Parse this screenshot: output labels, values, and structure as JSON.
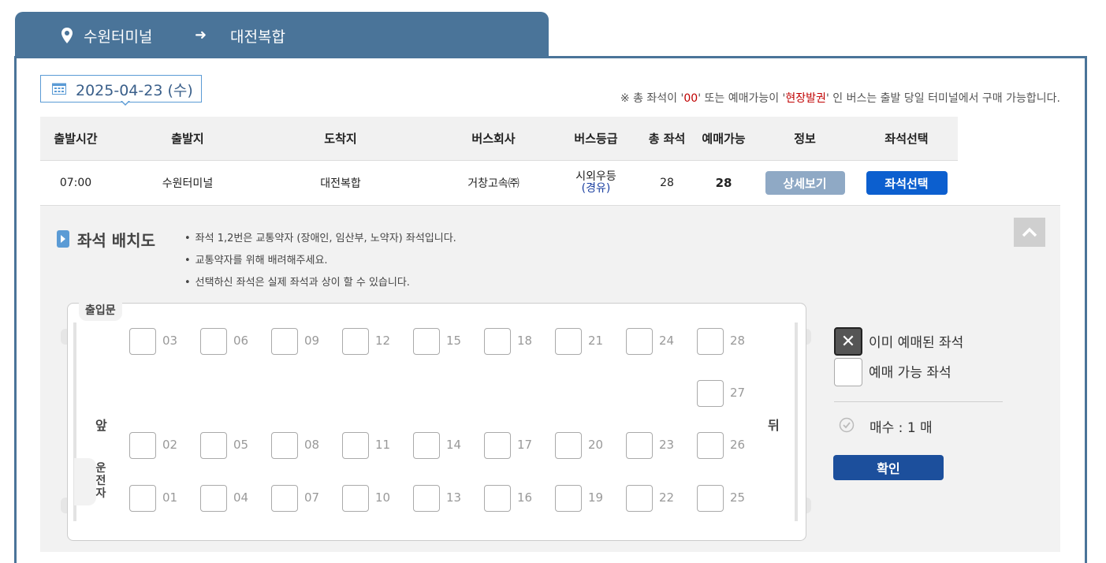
{
  "route": {
    "origin": "수원터미널",
    "arrow": "➜",
    "destination": "대전복합"
  },
  "date": {
    "label": "2025-04-23 (수)"
  },
  "notice": {
    "part1": "※ 총 좌석이 '",
    "red1": "00",
    "part2": "' 또는 예매가능이 '",
    "red2": "현장발권",
    "part3": "' 인 버스는 출발 당일 터미널에서 구매 가능합니다."
  },
  "table": {
    "headers": [
      "출발시간",
      "출발지",
      "도착지",
      "버스회사",
      "버스등급",
      "총 좌석",
      "예매가능",
      "정보",
      "좌석선택"
    ],
    "row": {
      "time": "07:00",
      "origin": "수원터미널",
      "destination": "대전복합",
      "company": "거창고속㈜",
      "grade": "시외우등",
      "grade_sub": "(경유)",
      "total_seats": "28",
      "available": "28",
      "detail_label": "상세보기",
      "select_label": "좌석선택"
    }
  },
  "seat_map": {
    "title": "좌석 배치도",
    "notes": [
      "좌석 1,2번은 교통약자 (장애인, 임산부, 노약자) 좌석입니다.",
      "교통약자를 위해 배려해주세요.",
      "선택하신 좌석은 실제 좌석과 상이 할 수 있습니다."
    ],
    "door_label": "출입문",
    "front_label": "앞",
    "back_label": "뒤",
    "driver_label": "운전자",
    "seats": {
      "s01": "01",
      "s02": "02",
      "s03": "03",
      "s04": "04",
      "s05": "05",
      "s06": "06",
      "s07": "07",
      "s08": "08",
      "s09": "09",
      "s10": "10",
      "s11": "11",
      "s12": "12",
      "s13": "13",
      "s14": "14",
      "s15": "15",
      "s16": "16",
      "s17": "17",
      "s18": "18",
      "s19": "19",
      "s20": "20",
      "s21": "21",
      "s22": "22",
      "s23": "23",
      "s24": "24",
      "s25": "25",
      "s26": "26",
      "s27": "27",
      "s28": "28"
    }
  },
  "legend": {
    "taken_label": "이미 예매된 좌석",
    "free_label": "예매 가능 좌석",
    "count_label": "매수 : 1 매",
    "confirm_label": "확인"
  },
  "colors": {
    "header_blue": "#4a7499",
    "select_button": "#0c5fcf",
    "detail_button": "#8fa9c5",
    "confirm_button": "#1c4f9c",
    "notice_red": "#c00000"
  }
}
